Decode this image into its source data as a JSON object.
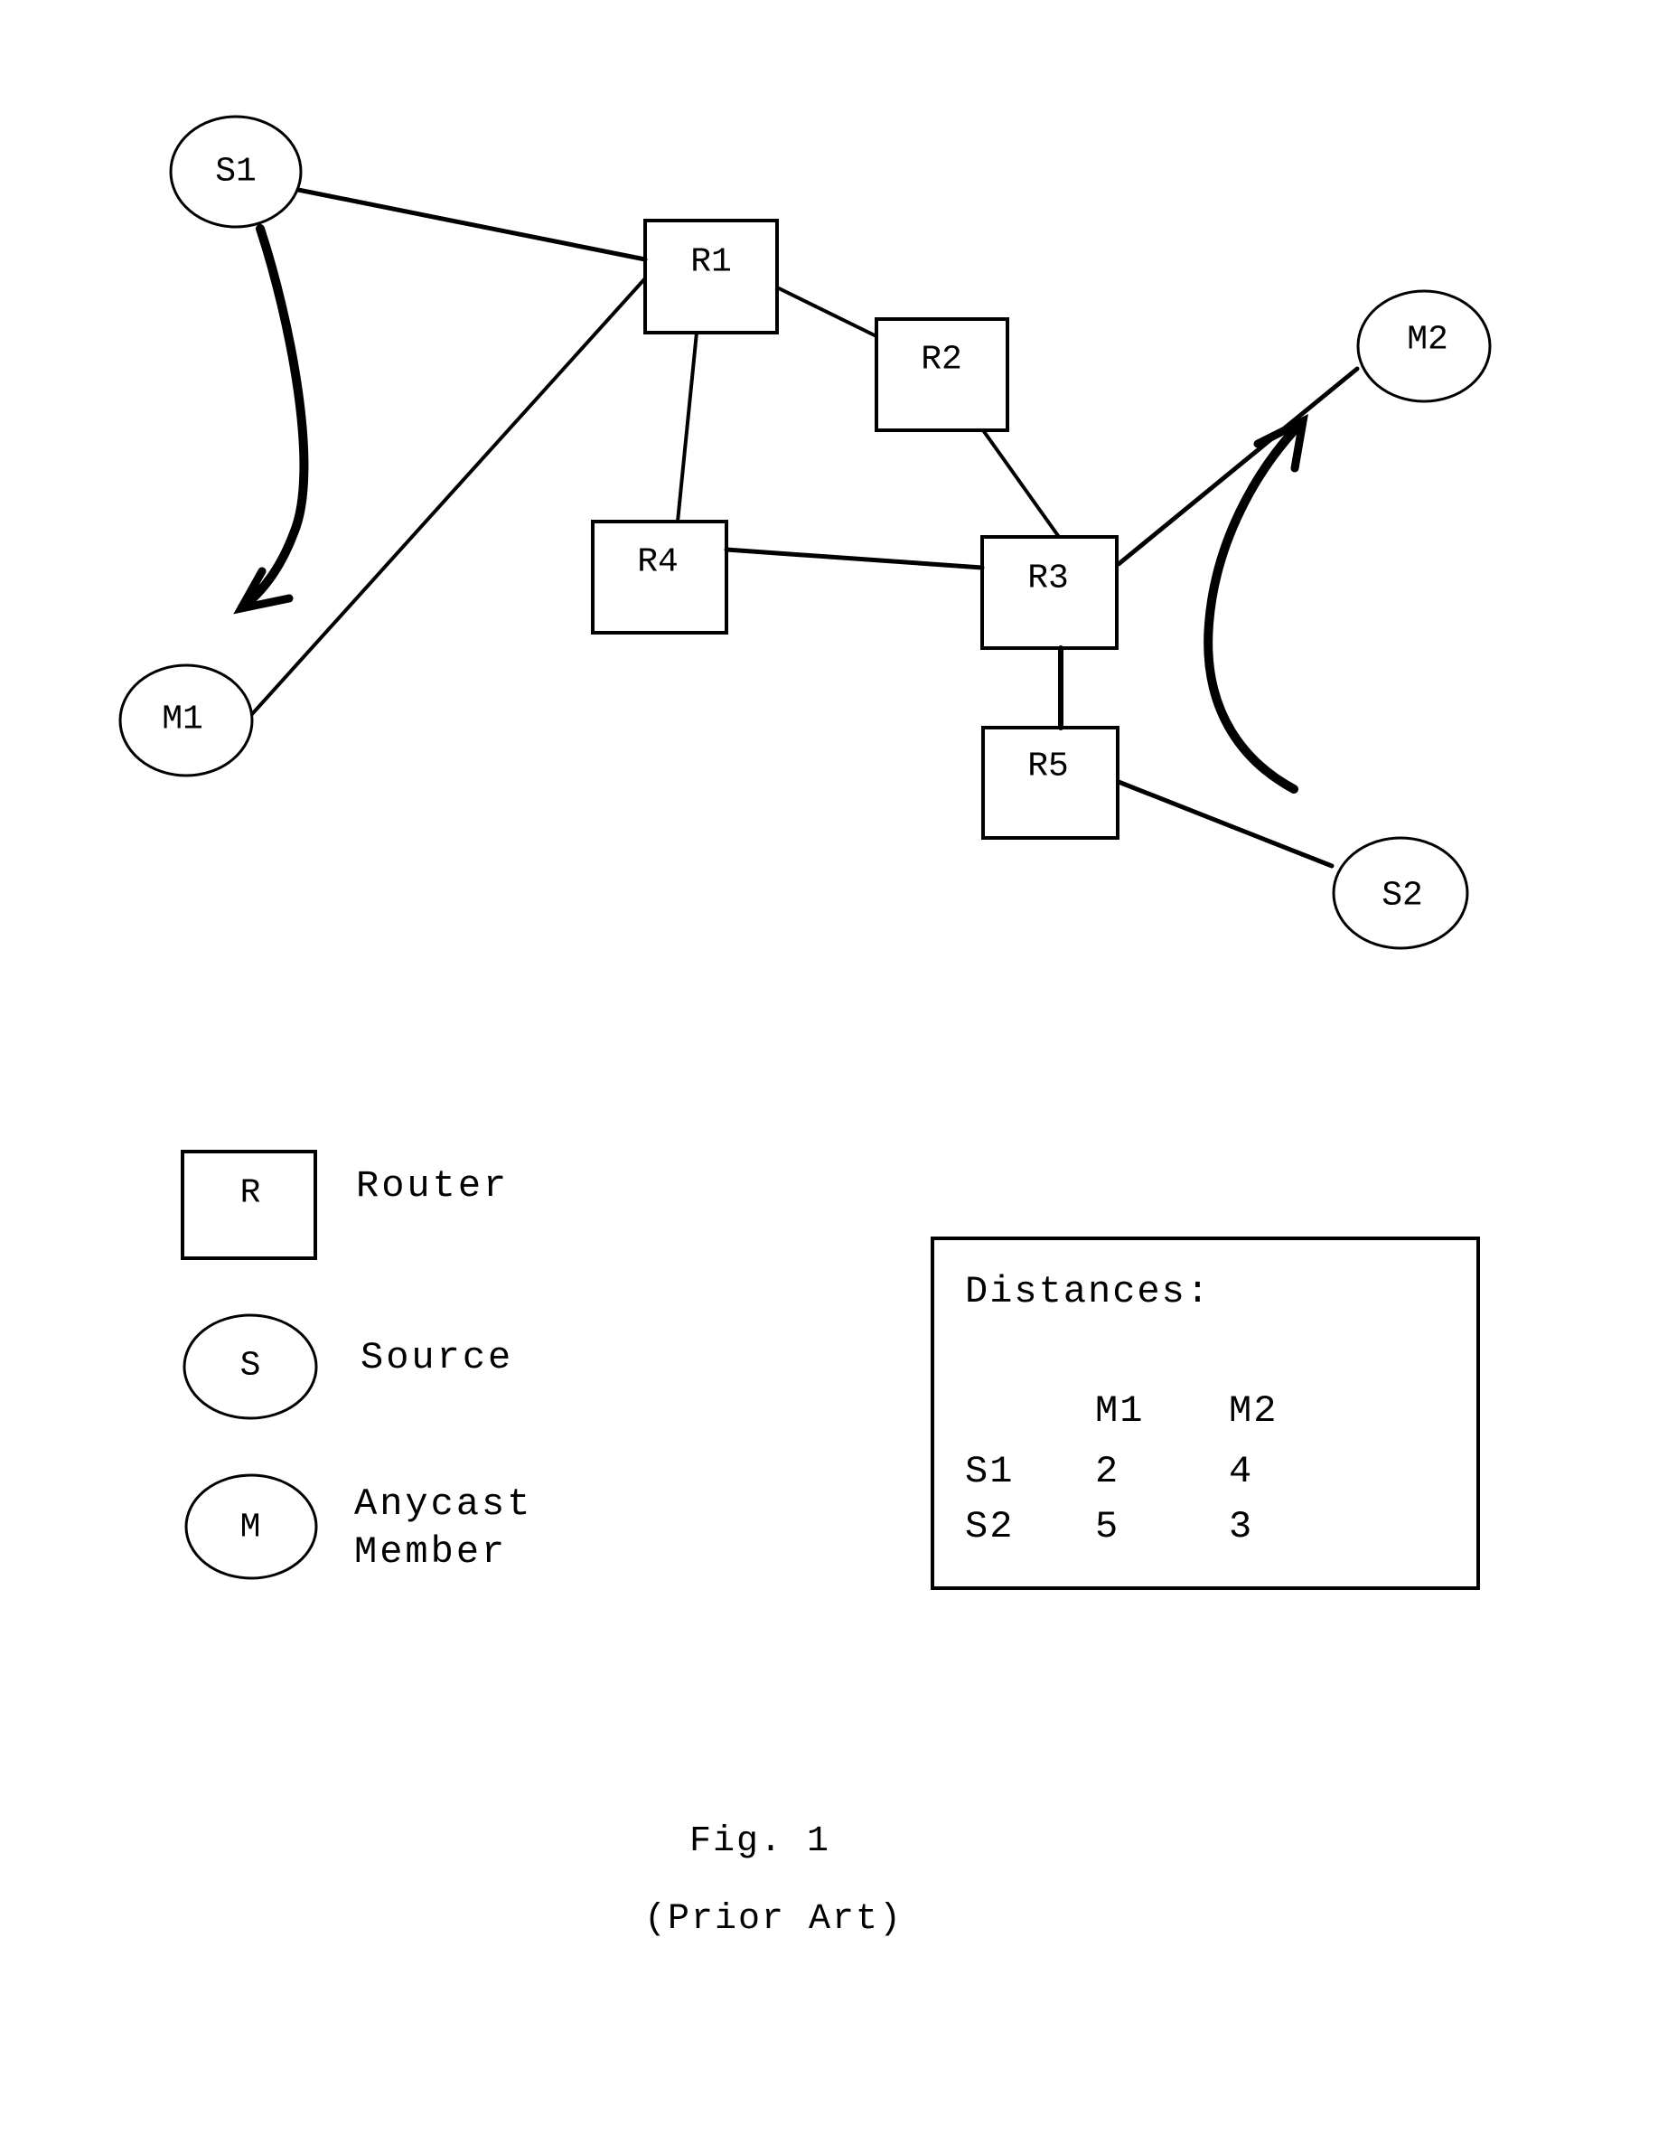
{
  "diagram": {
    "nodes": [
      {
        "id": "S1",
        "label": "S1",
        "kind": "source"
      },
      {
        "id": "M1",
        "label": "M1",
        "kind": "anycast-member"
      },
      {
        "id": "R1",
        "label": "R1",
        "kind": "router"
      },
      {
        "id": "R2",
        "label": "R2",
        "kind": "router"
      },
      {
        "id": "R3",
        "label": "R3",
        "kind": "router"
      },
      {
        "id": "R4",
        "label": "R4",
        "kind": "router"
      },
      {
        "id": "R5",
        "label": "R5",
        "kind": "router"
      },
      {
        "id": "M2",
        "label": "M2",
        "kind": "anycast-member"
      },
      {
        "id": "S2",
        "label": "S2",
        "kind": "source"
      }
    ],
    "links": [
      [
        "S1",
        "R1"
      ],
      [
        "M1",
        "R1"
      ],
      [
        "R1",
        "R2"
      ],
      [
        "R1",
        "R4"
      ],
      [
        "R2",
        "R3"
      ],
      [
        "R4",
        "R3"
      ],
      [
        "R3",
        "M2"
      ],
      [
        "R3",
        "R5"
      ],
      [
        "R5",
        "S2"
      ]
    ],
    "flows": [
      {
        "from": "S1",
        "to": "M1"
      },
      {
        "from": "S2",
        "to": "M2"
      }
    ]
  },
  "legend": {
    "router": {
      "symbol": "R",
      "label": "Router"
    },
    "source": {
      "symbol": "S",
      "label": "Source"
    },
    "member": {
      "symbol": "M",
      "label_line1": "Anycast",
      "label_line2": "Member"
    }
  },
  "distances": {
    "title": "Distances:",
    "columns": [
      "M1",
      "M2"
    ],
    "rows": [
      {
        "label": "S1",
        "values": [
          "2",
          "4"
        ]
      },
      {
        "label": "S2",
        "values": [
          "5",
          "3"
        ]
      }
    ]
  },
  "caption": {
    "figure": "Fig. 1",
    "note": "(Prior Art)"
  }
}
